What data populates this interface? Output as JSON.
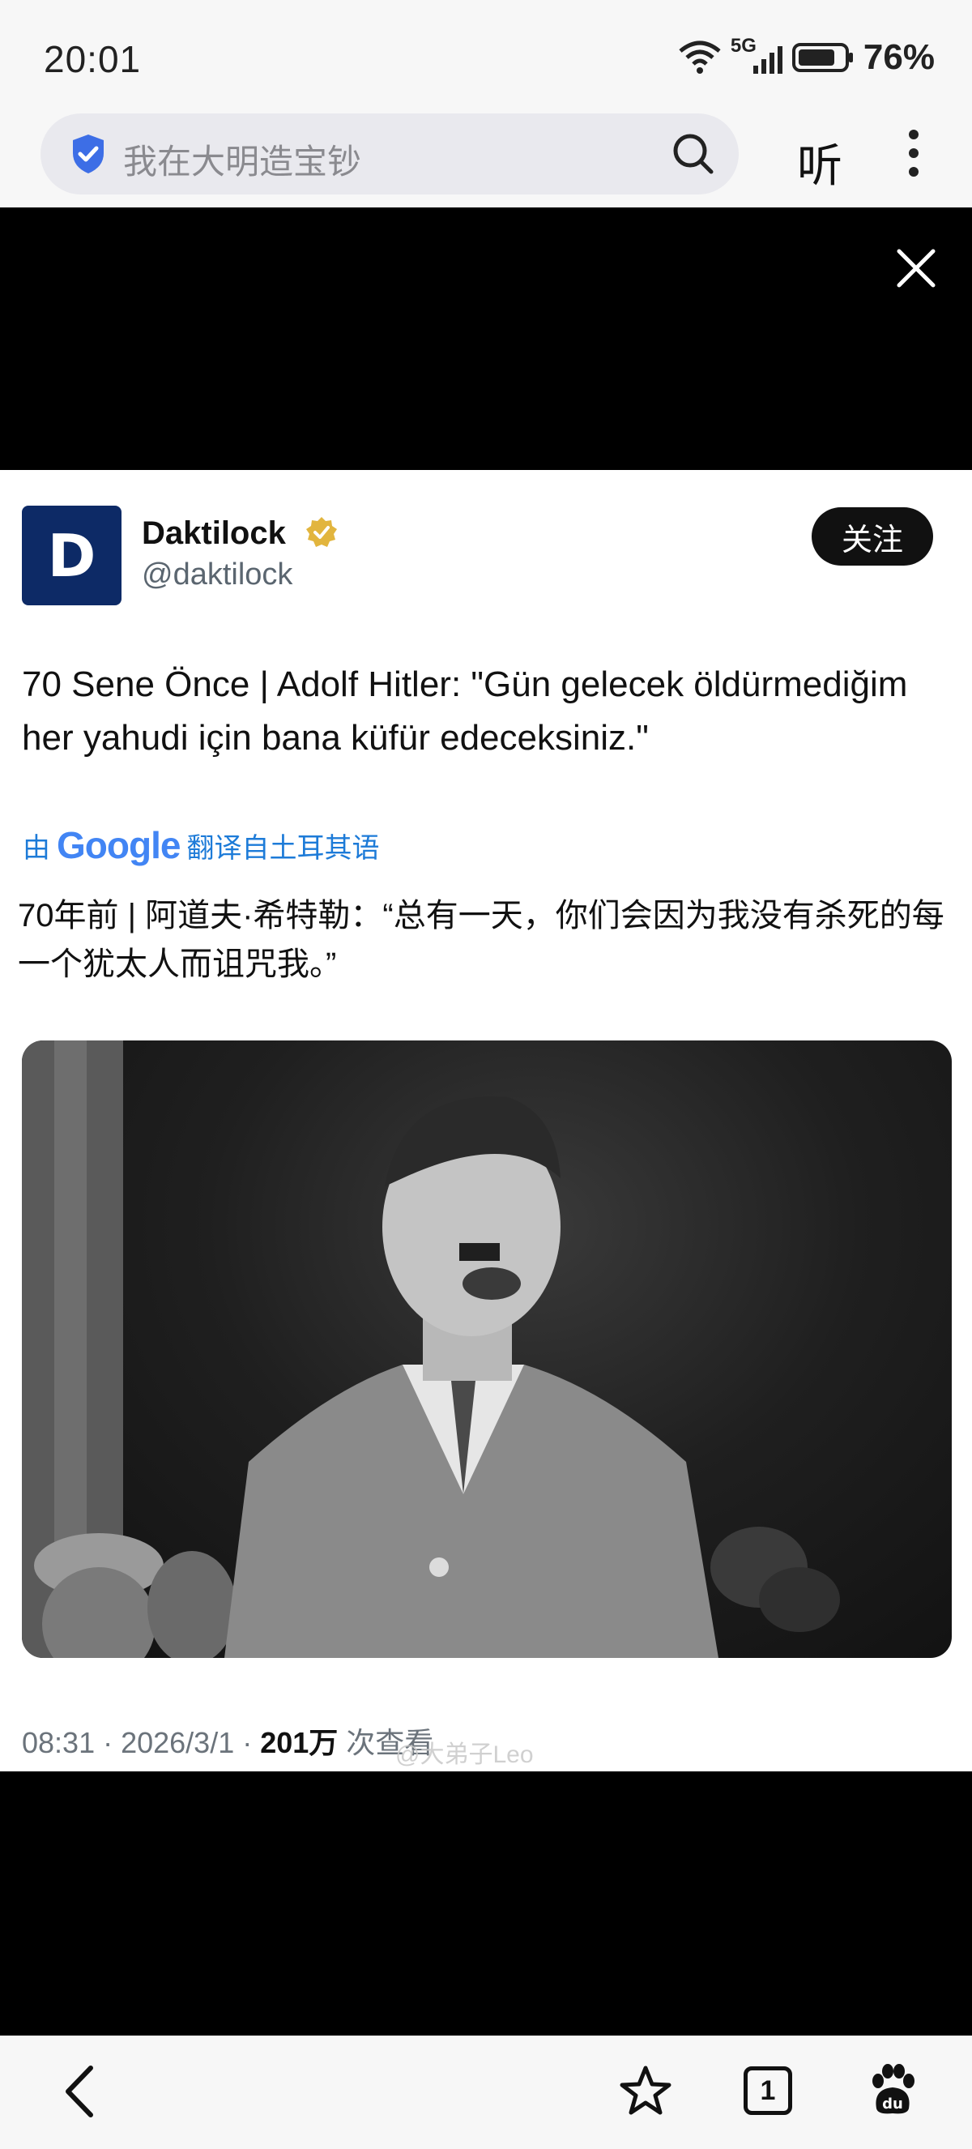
{
  "status_bar": {
    "time": "20:01",
    "network": "5G",
    "battery": "76%"
  },
  "browser": {
    "search_text": "我在大明造宝钞",
    "listen_label": "听"
  },
  "post": {
    "author_name": "Daktilock",
    "author_handle": "@daktilock",
    "avatar_letter": "D",
    "follow_label": "关注",
    "text": "70 Sene Önce | Adolf Hitler: \"Gün gelecek öldürmediğim her yahudi için bana küfür edeceksiniz.\"",
    "translate_prefix": "由",
    "translate_brand": "Google",
    "translate_suffix": "翻译自土耳其语",
    "translated_text": "70年前 | 阿道夫·希特勒：“总有一天，你们会因为我没有杀死的每一个犹太人而诅咒我。”",
    "meta_time_date": "08:31 · 2026/3/1 · ",
    "meta_views": "201万",
    "meta_views_label": " 次查看"
  },
  "watermark": "@大弟子Leo",
  "colors": {
    "accent_blue": "#1d7bd8",
    "avatar_bg": "#0d2a66",
    "verified_gold": "#e2b53e"
  },
  "icons": {
    "bottom_nav": [
      "back-icon",
      "star-icon",
      "tabs-icon",
      "baidu-paw-icon"
    ],
    "tab_count": "1"
  }
}
